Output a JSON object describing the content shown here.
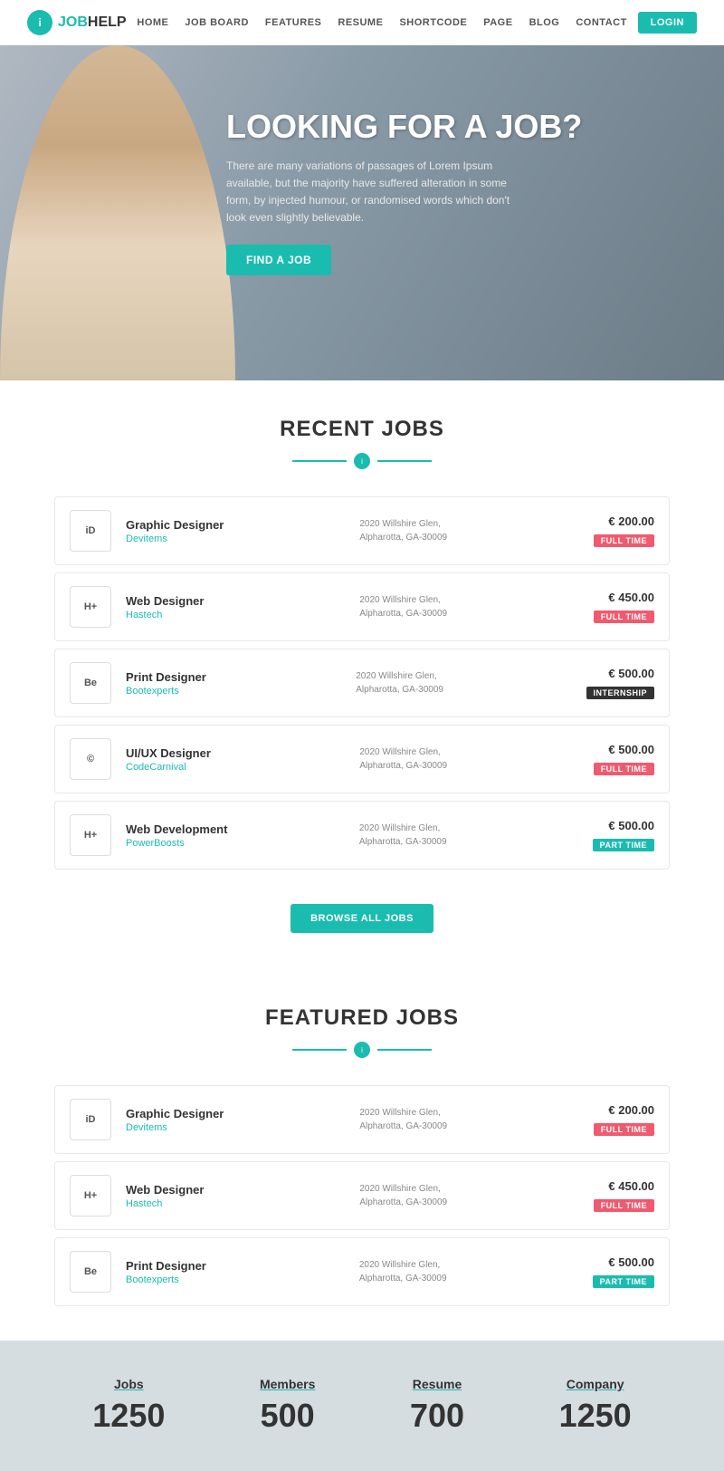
{
  "nav": {
    "logo": "JOBHELP",
    "logo_prefix": "JOB",
    "logo_suffix": "HELP",
    "links": [
      "HOME",
      "JOB BOARD",
      "FEATURES",
      "RESUME",
      "SHORTCODE",
      "PAGE",
      "BLOG",
      "CONTACT"
    ],
    "login_label": "LOGIN"
  },
  "hero": {
    "title": "LOOKING FOR A JOB?",
    "subtitle": "There are many variations of passages of Lorem Ipsum available, but the majority have suffered alteration in some form, by injected humour, or randomised words which don't look even slightly believable.",
    "cta_label": "FIND A JOB"
  },
  "recent_jobs": {
    "title": "RECENT JOBS",
    "jobs": [
      {
        "logo": "iD",
        "title": "Graphic Designer",
        "company": "Devitems",
        "address": "2020 Willshire Glen,\nAlpharotta, GA-30009",
        "salary": "€ 200.00",
        "badge": "FULL TIME",
        "badge_type": "fulltime"
      },
      {
        "logo": "H+",
        "title": "Web Designer",
        "company": "Hastech",
        "address": "2020 Willshire Glen,\nAlpharotta, GA-30009",
        "salary": "€ 450.00",
        "badge": "FULL TIME",
        "badge_type": "fulltime"
      },
      {
        "logo": "Be",
        "title": "Print Designer",
        "company": "Bootexperts",
        "address": "2020 Willshire Glen,\nAlpharotta, GA-30009",
        "salary": "€ 500.00",
        "badge": "INTERNSHIP",
        "badge_type": "internship"
      },
      {
        "logo": "©",
        "title": "UI/UX Designer",
        "company": "CodeCarnival",
        "address": "2020 Willshire Glen,\nAlpharotta, GA-30009",
        "salary": "€ 500.00",
        "badge": "FULL TIME",
        "badge_type": "fulltime"
      },
      {
        "logo": "H+",
        "title": "Web Development",
        "company": "PowerBoosts",
        "address": "2020 Willshire Glen,\nAlpharotta, GA-30009",
        "salary": "€ 500.00",
        "badge": "PART TIME",
        "badge_type": "parttime"
      }
    ],
    "browse_label": "BROWSE ALL JOBS"
  },
  "featured_jobs": {
    "title": "FEATURED JOBS",
    "jobs": [
      {
        "logo": "iD",
        "title": "Graphic Designer",
        "company": "Devitems",
        "address": "2020 Willshire Glen,\nAlpharotta, GA-30009",
        "salary": "€ 200.00",
        "badge": "FULL TIME",
        "badge_type": "fulltime"
      },
      {
        "logo": "H+",
        "title": "Web Designer",
        "company": "Hastech",
        "address": "2020 Willshire Glen,\nAlpharotta, GA-30009",
        "salary": "€ 450.00",
        "badge": "FULL TIME",
        "badge_type": "fulltime"
      },
      {
        "logo": "Be",
        "title": "Print Designer",
        "company": "Bootexperts",
        "address": "2020 Willshire Glen,\nAlpharotta, GA-30009",
        "salary": "€ 500.00",
        "badge": "PART TIME",
        "badge_type": "parttime"
      }
    ]
  },
  "stats": {
    "items": [
      {
        "label": "Jobs",
        "value": "1250"
      },
      {
        "label": "Members",
        "value": "500"
      },
      {
        "label": "Resume",
        "value": "700"
      },
      {
        "label": "Company",
        "value": "1250"
      }
    ]
  }
}
